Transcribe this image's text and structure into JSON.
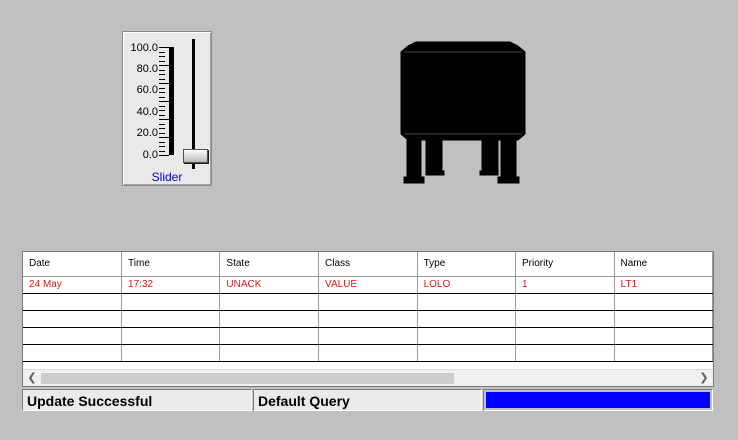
{
  "slider": {
    "scale_labels": [
      "100.0",
      "80.0",
      "60.0",
      "40.0",
      "20.0",
      "0.0"
    ],
    "caption": "Slider",
    "value": 0.0,
    "min": 0.0,
    "max": 100.0
  },
  "tank": {
    "icon": "tank-icon",
    "color": "#000000"
  },
  "alarm_grid": {
    "columns": [
      "Date",
      "Time",
      "State",
      "Class",
      "Type",
      "Priority",
      "Name"
    ],
    "rows": [
      [
        "24 May",
        "17:32",
        "UNACK",
        "VALUE",
        "LOLO",
        "1",
        "LT1"
      ]
    ],
    "active_color": "#e01818"
  },
  "status_bar": {
    "message": "Update Successful",
    "query": "Default Query",
    "progress": 1.0,
    "progress_color": "#0000ff"
  }
}
